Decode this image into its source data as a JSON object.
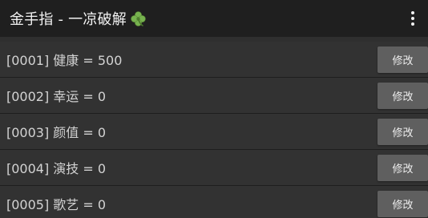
{
  "toolbar": {
    "title": "金手指 - 一凉破解",
    "emblem_icon": "four-leaf-clover-icon",
    "menu_icon": "more-vert-icon",
    "accent": "#88c057"
  },
  "entries": [
    {
      "label": "[0001] 健康 = 500",
      "button": "修改"
    },
    {
      "label": "[0002] 幸运 = 0",
      "button": "修改"
    },
    {
      "label": "[0003] 颜值 = 0",
      "button": "修改"
    },
    {
      "label": "[0004] 演技 = 0",
      "button": "修改"
    },
    {
      "label": "[0005] 歌艺 = 0",
      "button": "修改"
    }
  ]
}
